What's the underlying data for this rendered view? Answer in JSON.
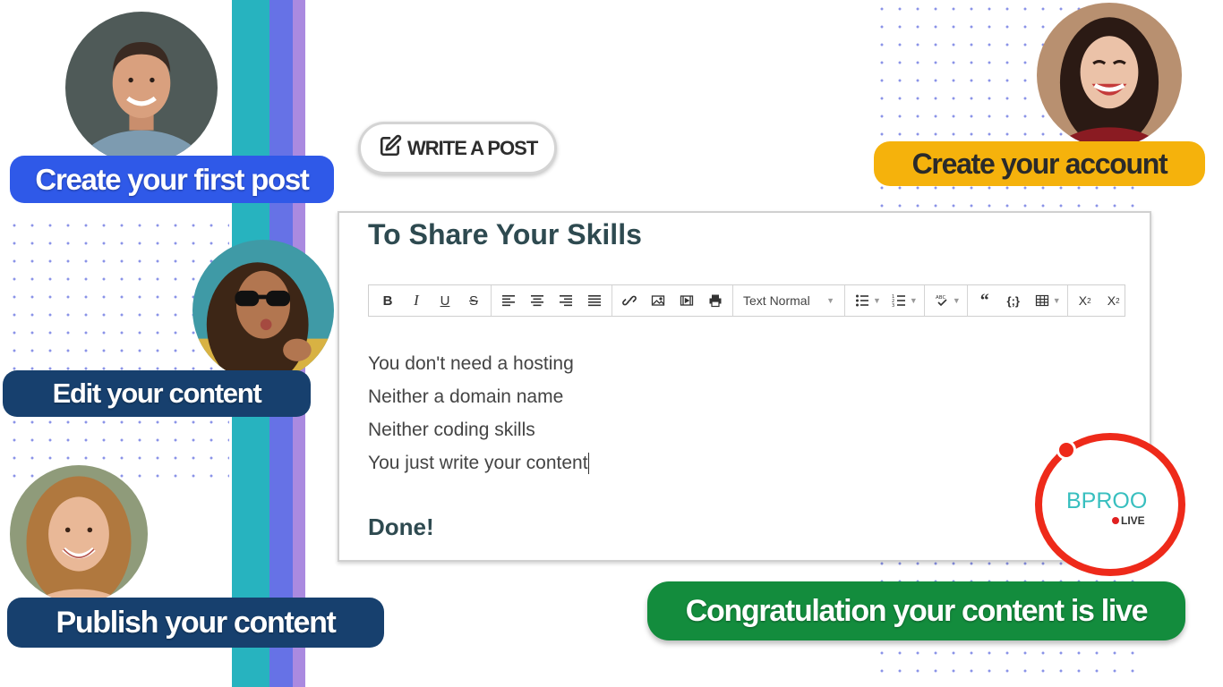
{
  "steps": {
    "first_post": "Create your first post",
    "edit": "Edit your content",
    "publish": "Publish your content",
    "account": "Create your account",
    "live": "Congratulation your content is live"
  },
  "write_post_button": {
    "label": "WRITE A POST",
    "icon": "edit-icon"
  },
  "editor": {
    "title": "To Share Your Skills",
    "toolbar": {
      "format_select": "Text Normal",
      "buttons": [
        "bold",
        "italic",
        "underline",
        "strikethrough",
        "align-left",
        "align-center",
        "align-right",
        "align-justify",
        "link",
        "image",
        "video",
        "print",
        "bullet-list",
        "numbered-list",
        "spellcheck",
        "blockquote",
        "code",
        "table",
        "subscript",
        "superscript"
      ]
    },
    "lines": [
      "You don't need a hosting",
      "Neither a domain name",
      "Neither coding skills",
      "You just write your content"
    ],
    "done": "Done!"
  },
  "logo": {
    "main": "BPROO",
    "sub": "LIVE"
  },
  "colors": {
    "stripe_teal": "#27b3bf",
    "stripe_blue": "#6672e6",
    "stripe_violet": "#aa8ae0",
    "pill_blue": "#2f59e8",
    "pill_navy": "#17406e",
    "pill_yellow": "#f5b20c",
    "pill_green": "#138c3d",
    "logo_red": "#ee2a1a",
    "logo_teal": "#38bfbf"
  }
}
